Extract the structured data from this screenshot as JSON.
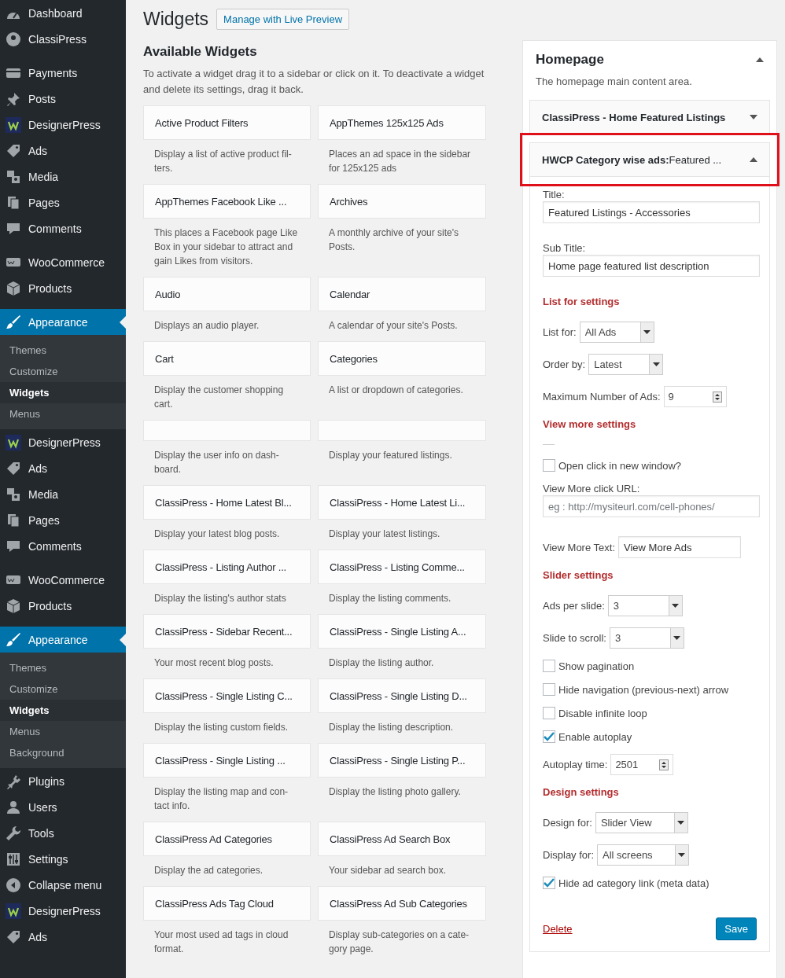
{
  "sidebar": {
    "groups": [
      {
        "items": [
          {
            "label": "Dashboard",
            "kind": "gauge",
            "selected": false
          },
          {
            "label": "ClassiPress",
            "kind": "pin-circle",
            "selected": false
          }
        ]
      },
      {
        "items": [
          {
            "label": "Payments",
            "kind": "card",
            "selected": false
          },
          {
            "label": "Posts",
            "kind": "pin",
            "selected": false
          },
          {
            "label": "DesignerPress",
            "kind": "logo",
            "selected": false
          },
          {
            "label": "Ads",
            "kind": "tag",
            "selected": false
          },
          {
            "label": "Media",
            "kind": "media",
            "selected": false
          },
          {
            "label": "Pages",
            "kind": "pages",
            "selected": false
          },
          {
            "label": "Comments",
            "kind": "bubble",
            "selected": false
          }
        ]
      },
      {
        "items": [
          {
            "label": "WooCommerce",
            "kind": "woo",
            "selected": false
          },
          {
            "label": "Products",
            "kind": "box",
            "selected": false
          }
        ]
      },
      {
        "items": [
          {
            "label": "Appearance",
            "kind": "brush",
            "selected": true,
            "children": [
              {
                "label": "Themes",
                "selected": false
              },
              {
                "label": "Customize",
                "selected": false
              },
              {
                "label": "Widgets",
                "selected": true
              },
              {
                "label": "Menus",
                "selected": false
              }
            ]
          },
          {
            "label": "DesignerPress",
            "kind": "logo",
            "selected": false
          },
          {
            "label": "Ads",
            "kind": "tag",
            "selected": false
          },
          {
            "label": "Media",
            "kind": "media",
            "selected": false
          },
          {
            "label": "Pages",
            "kind": "pages",
            "selected": false
          },
          {
            "label": "Comments",
            "kind": "bubble",
            "selected": false
          }
        ]
      },
      {
        "items": [
          {
            "label": "WooCommerce",
            "kind": "woo",
            "selected": false
          },
          {
            "label": "Products",
            "kind": "box",
            "selected": false
          }
        ]
      },
      {
        "items": [
          {
            "label": "Appearance",
            "kind": "brush",
            "selected": true,
            "children": [
              {
                "label": "Themes",
                "selected": false
              },
              {
                "label": "Customize",
                "selected": false
              },
              {
                "label": "Widgets",
                "selected": true
              },
              {
                "label": "Menus",
                "selected": false
              },
              {
                "label": "Background",
                "selected": false
              }
            ]
          },
          {
            "label": "Plugins",
            "kind": "plug",
            "selected": false
          },
          {
            "label": "Users",
            "kind": "user",
            "selected": false
          },
          {
            "label": "Tools",
            "kind": "wrench",
            "selected": false
          },
          {
            "label": "Settings",
            "kind": "sliders",
            "selected": false
          },
          {
            "label": "Collapse menu",
            "kind": "collapse",
            "selected": false
          },
          {
            "label": "DesignerPress",
            "kind": "logo",
            "selected": false
          },
          {
            "label": "Ads",
            "kind": "tag",
            "selected": false
          }
        ]
      }
    ]
  },
  "page": {
    "title": "Widgets",
    "action": "Manage with Live Preview"
  },
  "available": {
    "heading": "Available Widgets",
    "description": "To activate a widget drag it to a sidebar or click on it. To deactivate a widget and delete its settings, drag it back.",
    "widgets": [
      {
        "title": "Active Product Filters",
        "description": "Display a list of active product fil-ters."
      },
      {
        "title": "AppThemes 125x125 Ads",
        "description": "Places an ad space in the sidebar for 125x125 ads"
      },
      {
        "title": "AppThemes Facebook Like ...",
        "description": "This places a Facebook page Like Box in your sidebar to attract and gain Likes from visitors."
      },
      {
        "title": "Archives",
        "description": "A monthly archive of your site's Posts."
      },
      {
        "title": "Audio",
        "description": "Displays an audio player."
      },
      {
        "title": "Calendar",
        "description": "A calendar of your site's Posts."
      },
      {
        "title": "Cart",
        "description": "Display the customer shopping cart."
      },
      {
        "title": "Categories",
        "description": "A list or dropdown of categories."
      },
      {
        "description": "Display the user info on dash-board."
      },
      {
        "description": "Display your featured listings."
      },
      {
        "title": "ClassiPress - Home Latest Bl...",
        "description": "Display your latest blog posts."
      },
      {
        "title": "ClassiPress - Home Latest Li...",
        "description": "Display your latest listings."
      },
      {
        "title": "ClassiPress - Listing Author ...",
        "description": "Display the listing's author stats"
      },
      {
        "title": "ClassiPress - Listing Comme...",
        "description": "Display the listing comments."
      },
      {
        "title": "ClassiPress - Sidebar Recent...",
        "description": "Your most recent blog posts."
      },
      {
        "title": "ClassiPress - Single Listing A...",
        "description": "Display the listing author."
      },
      {
        "title": "ClassiPress - Single Listing C...",
        "description": "Display the listing custom fields."
      },
      {
        "title": "ClassiPress - Single Listing D...",
        "description": "Display the listing description."
      },
      {
        "title": "ClassiPress - Single Listing ...",
        "description": "Display the listing map and con-tact info."
      },
      {
        "title": "ClassiPress - Single Listing P...",
        "description": "Display the listing photo gallery."
      },
      {
        "title": "ClassiPress Ad Categories",
        "description": "Display the ad categories."
      },
      {
        "title": "ClassiPress Ad Search Box",
        "description": "Your sidebar ad search box."
      },
      {
        "title": "ClassiPress Ads Tag Cloud",
        "description": "Your most used ad tags in cloud format."
      },
      {
        "title": "ClassiPress Ad Sub Categories",
        "description": "Display sub-categories on a cate-gory page."
      }
    ]
  },
  "sidebar_area": {
    "title": "Homepage",
    "description": "The homepage main content area.",
    "expanded": true,
    "widgets": [
      {
        "title": "ClassiPress - Home Featured Listings",
        "expanded": false,
        "highlighted": false
      },
      {
        "title": "HWCP Category wise ads:",
        "subtitle": "Featured ...",
        "expanded": true,
        "highlighted": true,
        "fields": [
          {
            "kind": "text",
            "label": "Title:",
            "value": "Featured Listings - Accessories"
          },
          {
            "kind": "text",
            "label": "Sub Title:",
            "value": "Home page featured list description"
          },
          {
            "kind": "heading",
            "label": "List for settings"
          },
          {
            "kind": "select",
            "label": "List for:",
            "value": "All Ads"
          },
          {
            "kind": "select",
            "label": "Order by:",
            "value": "Latest"
          },
          {
            "kind": "number",
            "label": "Maximum Number of Ads:",
            "value": "9"
          },
          {
            "kind": "heading",
            "label": "View more settings"
          },
          {
            "kind": "rule"
          },
          {
            "kind": "checkbox",
            "label": "Open click in new window?",
            "checked": false
          },
          {
            "kind": "text",
            "label": "View More click URL:",
            "placeholder": "eg : http://mysiteurl.com/cell-phones/"
          },
          {
            "kind": "inline-text",
            "label": "View More Text:",
            "value": "View More Ads"
          },
          {
            "kind": "heading",
            "label": "Slider settings"
          },
          {
            "kind": "select",
            "label": "Ads per slide:",
            "value": "3"
          },
          {
            "kind": "select",
            "label": "Slide to scroll:",
            "value": "3"
          },
          {
            "kind": "checkbox",
            "label": "Show pagination",
            "checked": false
          },
          {
            "kind": "checkbox",
            "label": "Hide navigation (previous-next) arrow",
            "checked": false
          },
          {
            "kind": "checkbox",
            "label": "Disable infinite loop",
            "checked": false
          },
          {
            "kind": "checkbox",
            "label": "Enable autoplay",
            "checked": true
          },
          {
            "kind": "number",
            "label": "Autoplay time:",
            "value": "2501"
          },
          {
            "kind": "heading",
            "label": "Design settings"
          },
          {
            "kind": "select",
            "label": "Design for:",
            "value": "Slider View"
          },
          {
            "kind": "select",
            "label": "Display for:",
            "value": "All screens"
          },
          {
            "kind": "checkbox",
            "label": "Hide ad category link (meta data)",
            "checked": true
          }
        ],
        "delete": "Delete",
        "save": "Save"
      }
    ]
  }
}
